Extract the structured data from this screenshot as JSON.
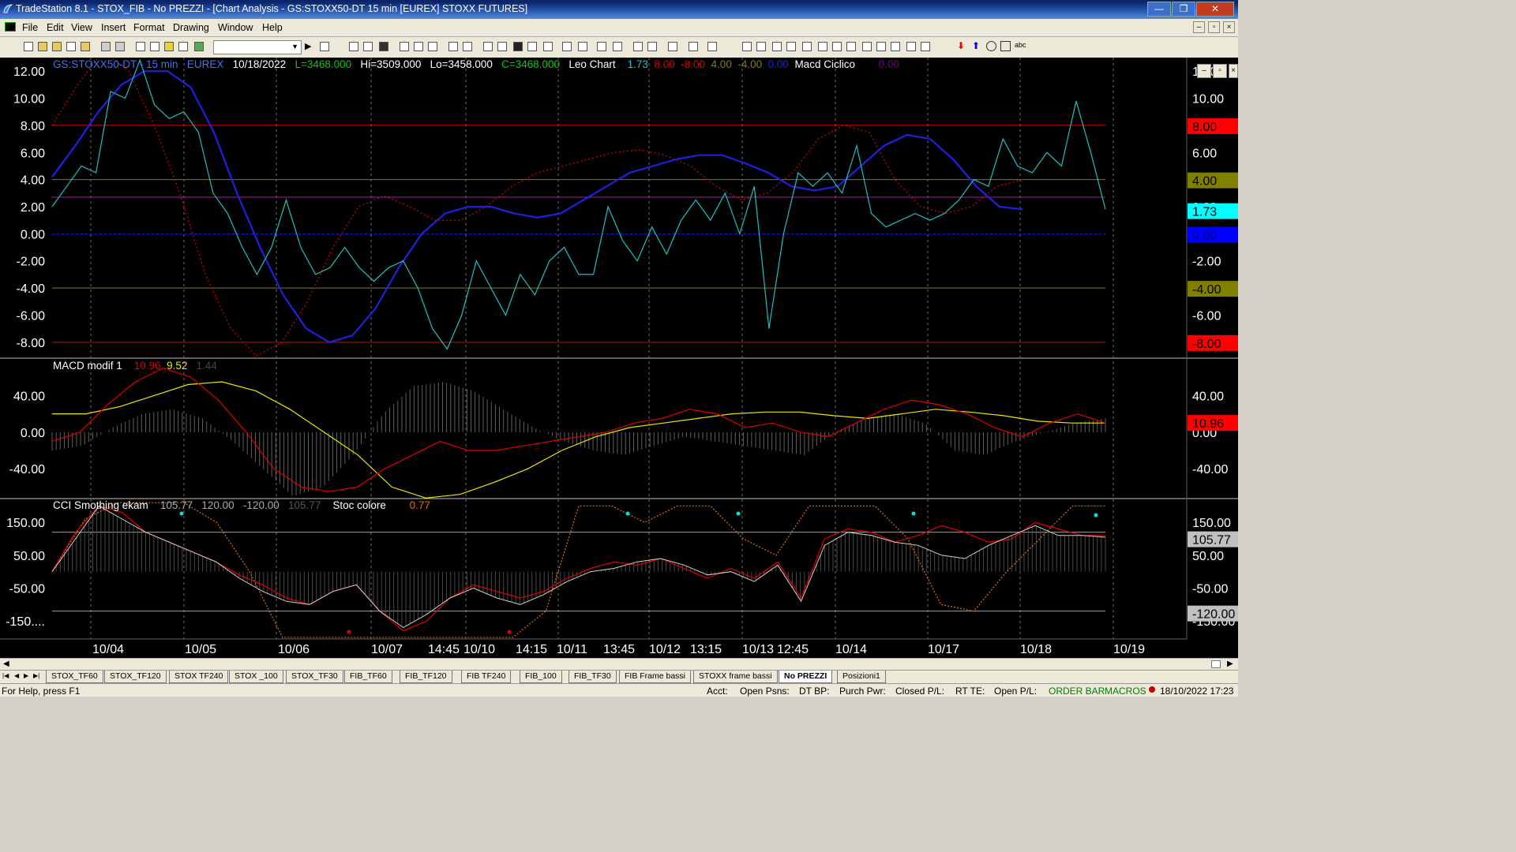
{
  "window": {
    "title": "TradeStation 8.1 - STOX_FIB - No PREZZI - [Chart Analysis - GS:STOXX50-DT  15 min  [EUREX] STOXX FUTURES]",
    "minimize": "—",
    "restore": "❐",
    "close": "✕"
  },
  "menu": [
    "File",
    "Edit",
    "View",
    "Insert",
    "Format",
    "Drawing",
    "Window",
    "Help"
  ],
  "chart_header": {
    "symbol": "GS:STOXX50-DT - 15 min",
    "exchange": "EUREX",
    "date": "10/18/2022",
    "last": "L=3468.000",
    "high": "Hi=3509.000",
    "low": "Lo=3458.000",
    "close": "C=3468.000",
    "indicator1": "Leo Chart",
    "v1": "1.73",
    "v2": "8.00",
    "v3": "-8.00",
    "v4": "4.00",
    "v5": "-4.00",
    "v6": "0.00",
    "indicator2": "Macd Ciclico",
    "v7": "0.00"
  },
  "macd_header": {
    "name": "MACD modif 1",
    "v1": "10.96",
    "v2": "9.52",
    "v3": "1.44"
  },
  "cci_header": {
    "name": "CCI Smothing ekam",
    "v1": "105.77",
    "v2": "120.00",
    "v3": "-120.00",
    "v4": "105.77",
    "name2": "Stoc colore",
    "v5": "0.77"
  },
  "axes": {
    "panel1_ticks": [
      "12.00",
      "10.00",
      "8.00",
      "6.00",
      "4.00",
      "2.00",
      "0.00",
      "-2.00",
      "-4.00",
      "-6.00",
      "-8.00"
    ],
    "panel2_ticks": [
      "40.00",
      "0.00",
      "-40.00"
    ],
    "panel3_ticks": [
      "150.00",
      "50.00",
      "-50.00",
      "-150...."
    ],
    "right_panel3_ticks": [
      "150.00",
      "50.00",
      "-50.00",
      "-150.00"
    ],
    "x_labels": [
      "10/04",
      "10/05",
      "10/06",
      "10/07",
      "14:45",
      "10/10",
      "14:15",
      "10/11",
      "13:45",
      "10/12",
      "13:15",
      "10/13",
      "12:45",
      "10/14",
      "10/17",
      "10/18",
      "10/19"
    ],
    "right_badges": {
      "p1": [
        {
          "text": "8.00",
          "bg": "#ff0000",
          "fg": "#000000"
        },
        {
          "text": "4.00",
          "bg": "#808000",
          "fg": "#000000"
        },
        {
          "text": "1.73",
          "bg": "#00ffff",
          "fg": "#000000"
        },
        {
          "text": "0.00",
          "bg": "#0000ff",
          "fg": "#000080"
        },
        {
          "text": "-4.00",
          "bg": "#808000",
          "fg": "#000000"
        },
        {
          "text": "-8.00",
          "bg": "#ff0000",
          "fg": "#000000"
        }
      ],
      "p2": [
        {
          "text": "10.96",
          "bg": "#ff0000",
          "fg": "#000000"
        }
      ],
      "p3": [
        {
          "text": "105.77",
          "bg": "#c0c0c0",
          "fg": "#000000"
        },
        {
          "text": "-120.00",
          "bg": "#c0c0c0",
          "fg": "#000000"
        }
      ]
    }
  },
  "tabs": [
    "STOX_TF60",
    "STOX_TF120",
    "STOX TF240",
    "STOX _100",
    "STOX_TF30",
    "FIB_TF60",
    "FIB_TF120",
    "FIB TF240",
    "FIB_100",
    "FIB_TF30",
    "FIB Frame bassi",
    "STOXX frame bassi",
    "No PREZZI",
    "Posizioni1"
  ],
  "active_tab": "No PREZZI",
  "status": {
    "help": "For Help, press F1",
    "acct": "Acct:",
    "open_psns": "Open Psns:",
    "dt_bp": "DT BP:",
    "purch_pwr": "Purch Pwr:",
    "closed_pl": "Closed P/L:",
    "rt_te": "RT TE:",
    "open_pl": "Open P/L:",
    "order_bar": "ORDER BAR",
    "macros": "MACROS",
    "datetime": "18/10/2022 17:23"
  },
  "colors": {
    "cyan": "#20c0c0",
    "blue": "#2020e0",
    "red": "#e00000",
    "yellow": "#e8e800",
    "olive": "#808000",
    "grey": "#909090"
  },
  "chart_data": [
    {
      "type": "line",
      "title": "Leo Chart",
      "ylim": [
        -9,
        13
      ],
      "series": [
        {
          "name": "Leo Chart",
          "values": [
            2.0,
            3.5,
            5.0,
            4.5,
            10.5,
            10.0,
            12.8,
            9.5,
            8.5,
            9.0,
            7.5,
            3.0,
            1.5,
            -1.0,
            -3.0,
            -1.0,
            2.5,
            -1.0,
            -3.0,
            -2.5,
            -1.0,
            -2.5,
            -3.5,
            -2.5,
            -2.0,
            -4.0,
            -7.0,
            -8.5,
            -6.0,
            -2.0,
            -4.0,
            -6.0,
            -3.0,
            -4.5,
            -2.0,
            -1.0,
            -3.0,
            -3.0,
            2.0,
            -0.5,
            -2.0,
            0.5,
            -1.5,
            1.0,
            2.5,
            1.0,
            3.0,
            0.0,
            3.5,
            -7.0,
            0.0,
            4.5,
            3.5,
            4.5,
            3.0,
            6.5,
            1.5,
            0.5,
            1.0,
            1.5,
            1.0,
            1.5,
            2.5,
            4.0,
            3.5,
            7.0,
            5.0,
            4.5,
            6.0,
            5.0,
            9.8,
            6.0,
            1.8
          ]
        },
        {
          "name": "Macd Ciclico",
          "values": [
            4.2,
            6.5,
            9.0,
            11.0,
            12.0,
            12.0,
            10.8,
            7.5,
            3.0,
            -1.0,
            -4.5,
            -7.0,
            -8.0,
            -7.5,
            -5.5,
            -2.5,
            0.0,
            1.5,
            2.0,
            2.0,
            1.5,
            1.2,
            1.5,
            2.5,
            3.5,
            4.5,
            5.0,
            5.5,
            5.8,
            5.8,
            5.2,
            4.5,
            3.5,
            3.2,
            3.5,
            5.0,
            6.5,
            7.3,
            7.0,
            5.5,
            3.5,
            2.0,
            1.8
          ]
        },
        {
          "name": "Red dotted",
          "values": [
            8.0,
            11.0,
            13.5,
            12.0,
            8.0,
            3.0,
            -3.0,
            -7.0,
            -9.0,
            -8.0,
            -5.0,
            -1.0,
            2.0,
            2.8,
            2.0,
            1.0,
            1.0,
            2.0,
            3.5,
            4.5,
            5.0,
            5.5,
            6.0,
            6.2,
            5.8,
            5.0,
            3.5,
            2.5,
            3.0,
            4.5,
            7.0,
            8.0,
            7.5,
            4.0,
            2.0,
            1.5,
            2.0,
            3.5,
            4.0
          ]
        }
      ],
      "hlines": [
        8.0,
        4.0,
        2.7,
        0.0,
        -4.0,
        -8.0
      ]
    },
    {
      "type": "line",
      "title": "MACD modif 1",
      "ylim": [
        -70,
        80
      ],
      "series": [
        {
          "name": "MACD",
          "values": [
            -10,
            0,
            30,
            55,
            70,
            60,
            35,
            0,
            -40,
            -60,
            -65,
            -60,
            -40,
            -25,
            -10,
            -20,
            -20,
            -15,
            -10,
            -5,
            0,
            10,
            15,
            25,
            20,
            5,
            10,
            0,
            -5,
            10,
            25,
            35,
            30,
            20,
            5,
            -5,
            10,
            20,
            10
          ]
        },
        {
          "name": "Signal",
          "values": [
            20,
            20,
            28,
            40,
            52,
            55,
            45,
            25,
            0,
            -25,
            -60,
            -72,
            -68,
            -55,
            -40,
            -20,
            -5,
            5,
            10,
            15,
            20,
            22,
            22,
            18,
            15,
            20,
            25,
            22,
            18,
            12,
            10,
            10
          ]
        },
        {
          "name": "Histogram",
          "values": [
            -20,
            -15,
            5,
            20,
            25,
            15,
            -10,
            -40,
            -70,
            -60,
            -25,
            20,
            50,
            55,
            45,
            25,
            5,
            -10,
            -20,
            -25,
            -15,
            -5,
            -10,
            -15,
            -20,
            -25,
            0,
            15,
            20,
            10,
            -20,
            -25,
            -10,
            0,
            10,
            15
          ]
        }
      ]
    },
    {
      "type": "line",
      "title": "CCI Smothing ekam",
      "ylim": [
        -200,
        220
      ],
      "series": [
        {
          "name": "CCI",
          "values": [
            0,
            100,
            200,
            160,
            120,
            90,
            60,
            30,
            -20,
            -60,
            -90,
            -100,
            -60,
            -40,
            -120,
            -170,
            -130,
            -80,
            -50,
            -80,
            -100,
            -70,
            -30,
            0,
            10,
            30,
            40,
            20,
            -10,
            0,
            -30,
            20,
            -90,
            80,
            120,
            110,
            90,
            80,
            50,
            40,
            80,
            110,
            140,
            110,
            110,
            105
          ]
        },
        {
          "name": "CCI red",
          "values": [
            0,
            120,
            200,
            180,
            120,
            90,
            60,
            30,
            -10,
            -40,
            -80,
            -100,
            -60,
            -40,
            -120,
            -180,
            -150,
            -80,
            -40,
            -60,
            -80,
            -60,
            -20,
            10,
            30,
            20,
            40,
            10,
            -20,
            10,
            -20,
            30,
            -80,
            100,
            130,
            120,
            90,
            110,
            140,
            120,
            90,
            100,
            150,
            130,
            110,
            110
          ]
        },
        {
          "name": "Stoc colore",
          "values": [
            0,
            160,
            210,
            210,
            210,
            150,
            0,
            -200,
            -200,
            -200,
            -200,
            -200,
            -200,
            -200,
            -200,
            -120,
            200,
            200,
            150,
            200,
            200,
            100,
            50,
            200,
            200,
            200,
            100,
            -100,
            -120,
            0,
            100,
            200,
            200
          ]
        }
      ],
      "hlines": [
        120,
        -120
      ]
    }
  ]
}
